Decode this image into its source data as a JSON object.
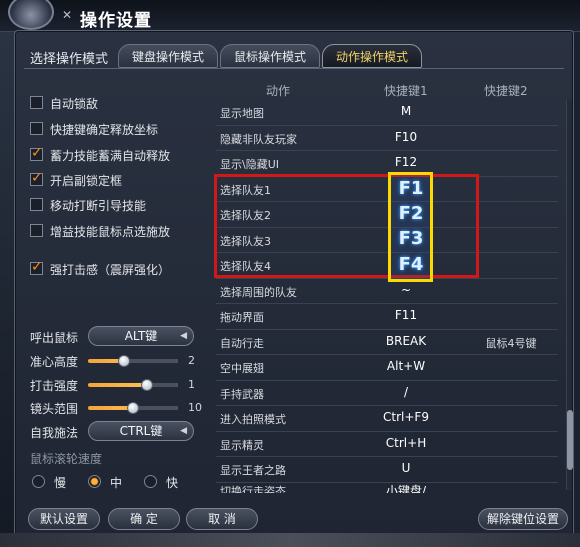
{
  "window": {
    "title": "操作设置"
  },
  "mode": {
    "label": "选择操作模式",
    "tabs": [
      {
        "label": "键盘操作模式",
        "active": false
      },
      {
        "label": "鼠标操作模式",
        "active": false
      },
      {
        "label": "动作操作模式",
        "active": true
      }
    ]
  },
  "options": [
    {
      "label": "自动锁敌",
      "checked": false
    },
    {
      "label": "快捷键确定释放坐标",
      "checked": false
    },
    {
      "label": "蓄力技能蓄满自动释放",
      "checked": true
    },
    {
      "label": "开启副锁定框",
      "checked": true
    },
    {
      "label": "移动打断引导技能",
      "checked": false
    },
    {
      "label": "增益技能鼠标点选施放",
      "checked": false
    },
    {
      "label": "强打击感（震屏强化）",
      "checked": true
    }
  ],
  "settings": {
    "call_mouse": {
      "label": "呼出鼠标",
      "value": "ALT键"
    },
    "aim_height": {
      "label": "准心高度",
      "value": "2",
      "level": 0.4
    },
    "hit_strength": {
      "label": "打击强度",
      "value": "1",
      "level": 0.65
    },
    "lens_range": {
      "label": "镜头范围",
      "value": "10",
      "level": 0.5
    },
    "self_cast": {
      "label": "自我施法",
      "value": "CTRL键"
    }
  },
  "scroll_speed": {
    "label": "鼠标滚轮速度",
    "options": [
      {
        "label": "慢",
        "selected": false
      },
      {
        "label": "中",
        "selected": true
      },
      {
        "label": "快",
        "selected": false
      }
    ]
  },
  "table": {
    "headers": [
      "动作",
      "快捷键1",
      "快捷键2"
    ],
    "rows": [
      {
        "action": "显示地图",
        "key1": "M",
        "key2": ""
      },
      {
        "action": "隐藏非队友玩家",
        "key1": "F10",
        "key2": ""
      },
      {
        "action": "显示\\隐藏UI",
        "key1": "F12",
        "key2": ""
      },
      {
        "action": "选择队友1",
        "key1": "F1",
        "key2": ""
      },
      {
        "action": "选择队友2",
        "key1": "F2",
        "key2": ""
      },
      {
        "action": "选择队友3",
        "key1": "F3",
        "key2": ""
      },
      {
        "action": "选择队友4",
        "key1": "F4",
        "key2": ""
      },
      {
        "action": "选择周围的队友",
        "key1": "~",
        "key2": ""
      },
      {
        "action": "拖动界面",
        "key1": "F11",
        "key2": ""
      },
      {
        "action": "自动行走",
        "key1": "BREAK",
        "key2": "鼠标4号键"
      },
      {
        "action": "空中展翅",
        "key1": "Alt+W",
        "key2": ""
      },
      {
        "action": "手持武器",
        "key1": "/",
        "key2": ""
      },
      {
        "action": "进入拍照模式",
        "key1": "Ctrl+F9",
        "key2": ""
      },
      {
        "action": "显示精灵",
        "key1": "Ctrl+H",
        "key2": ""
      },
      {
        "action": "显示王者之路",
        "key1": "U",
        "key2": ""
      },
      {
        "action": "切换行走姿态",
        "key1": "小键盘/",
        "key2": ""
      }
    ]
  },
  "buttons": {
    "default": "默认设置",
    "ok": "确 定",
    "cancel": "取 消",
    "unbind": "解除键位设置"
  },
  "colors": {
    "accent": "#ff8a1a",
    "highlight_red": "#d01818",
    "highlight_yellow": "#ffd800",
    "active_tab_text": "#f2d36a"
  }
}
